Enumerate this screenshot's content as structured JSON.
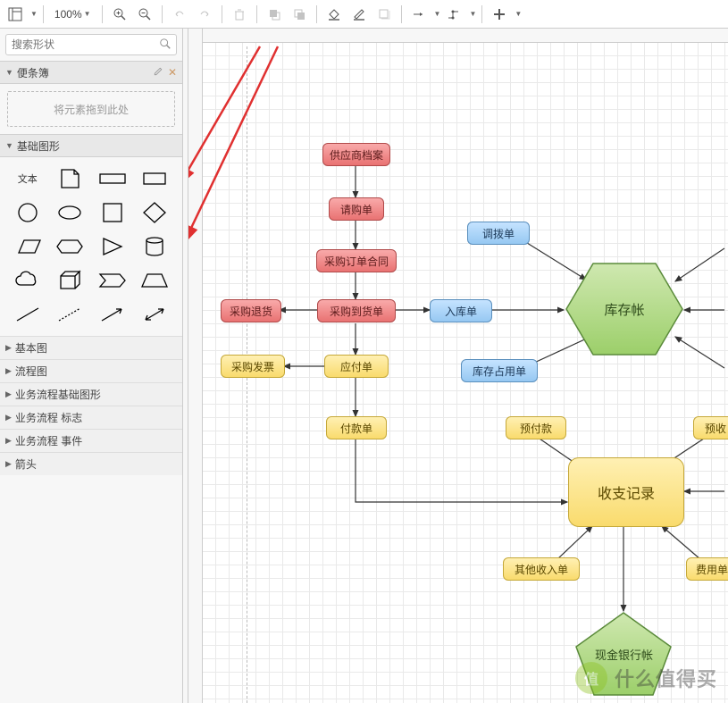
{
  "toolbar": {
    "zoom": "100%"
  },
  "sidebar": {
    "search_placeholder": "搜索形状",
    "scratchpad_title": "便条簿",
    "scratchpad_hint": "将元素拖到此处",
    "shapes_panel_title": "基础图形",
    "text_shape_label": "文本",
    "categories": {
      "c0": "基本图",
      "c1": "流程图",
      "c2": "业务流程基础图形",
      "c3": "业务流程 标志",
      "c4": "业务流程 事件",
      "c5": "箭头"
    }
  },
  "nodes": {
    "n_supplier": "供应商档案",
    "n_req": "请购单",
    "n_po": "采购订单合同",
    "n_receipt": "采购到货单",
    "n_return": "采购退货",
    "n_stockin": "入库单",
    "n_transfer": "调拨单",
    "n_inventory": "库存帐",
    "n_reserve": "库存占用单",
    "n_invoice": "采购发票",
    "n_ap": "应付单",
    "n_pay": "付款单",
    "n_prepay": "预付款",
    "n_prerecv": "预收",
    "n_io": "收支记录",
    "n_other": "其他收入单",
    "n_expense": "费用单",
    "n_cash": "现金银行帐"
  },
  "watermark": {
    "badge": "值",
    "text": "什么值得买"
  }
}
